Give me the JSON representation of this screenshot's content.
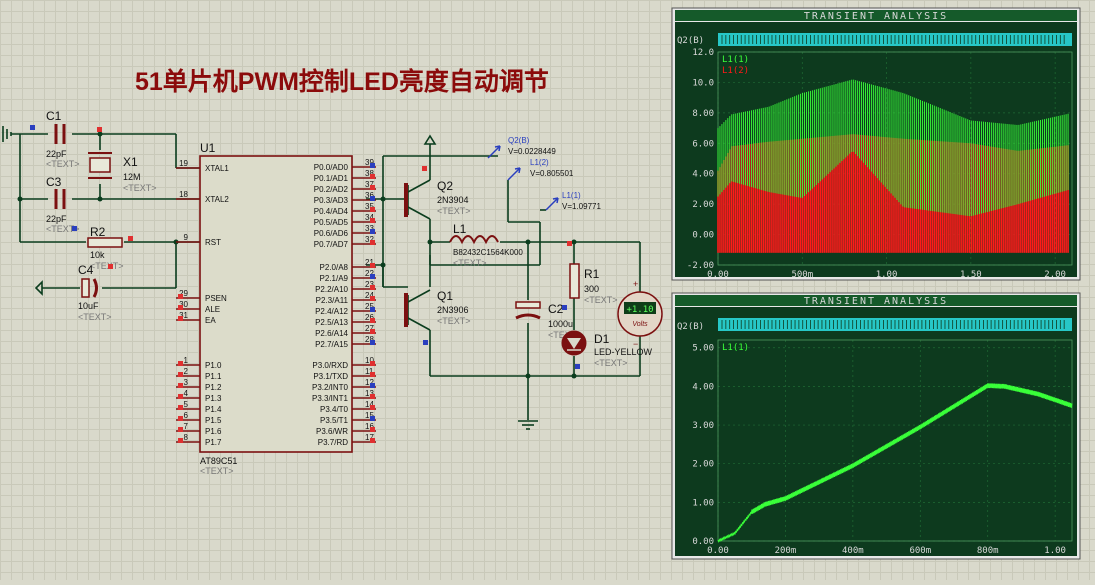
{
  "title": "51单片机PWM控制LED亮度自动调节",
  "mcu": {
    "ref": "U1",
    "part": "AT89C51",
    "text": "<TEXT>",
    "left_pins": [
      {
        "num": "19",
        "name": "XTAL1"
      },
      {
        "num": "18",
        "name": "XTAL2"
      },
      {
        "num": "9",
        "name": "RST"
      },
      {
        "num": "29",
        "name": "PSEN"
      },
      {
        "num": "30",
        "name": "ALE"
      },
      {
        "num": "31",
        "name": "EA"
      },
      {
        "num": "1",
        "name": "P1.0"
      },
      {
        "num": "2",
        "name": "P1.1"
      },
      {
        "num": "3",
        "name": "P1.2"
      },
      {
        "num": "4",
        "name": "P1.3"
      },
      {
        "num": "5",
        "name": "P1.4"
      },
      {
        "num": "6",
        "name": "P1.5"
      },
      {
        "num": "7",
        "name": "P1.6"
      },
      {
        "num": "8",
        "name": "P1.7"
      }
    ],
    "right_pins": [
      {
        "num": "39",
        "name": "P0.0/AD0"
      },
      {
        "num": "38",
        "name": "P0.1/AD1"
      },
      {
        "num": "37",
        "name": "P0.2/AD2"
      },
      {
        "num": "36",
        "name": "P0.3/AD3"
      },
      {
        "num": "35",
        "name": "P0.4/AD4"
      },
      {
        "num": "34",
        "name": "P0.5/AD5"
      },
      {
        "num": "33",
        "name": "P0.6/AD6"
      },
      {
        "num": "32",
        "name": "P0.7/AD7"
      },
      {
        "num": "21",
        "name": "P2.0/A8"
      },
      {
        "num": "22",
        "name": "P2.1/A9"
      },
      {
        "num": "23",
        "name": "P2.2/A10"
      },
      {
        "num": "24",
        "name": "P2.3/A11"
      },
      {
        "num": "25",
        "name": "P2.4/A12"
      },
      {
        "num": "26",
        "name": "P2.5/A13"
      },
      {
        "num": "27",
        "name": "P2.6/A14"
      },
      {
        "num": "28",
        "name": "P2.7/A15"
      },
      {
        "num": "10",
        "name": "P3.0/RXD"
      },
      {
        "num": "11",
        "name": "P3.1/TXD"
      },
      {
        "num": "12",
        "name": "P3.2/INT0"
      },
      {
        "num": "13",
        "name": "P3.3/INT1"
      },
      {
        "num": "14",
        "name": "P3.4/T0"
      },
      {
        "num": "15",
        "name": "P3.5/T1"
      },
      {
        "num": "16",
        "name": "P3.6/WR"
      },
      {
        "num": "17",
        "name": "P3.7/RD"
      }
    ]
  },
  "components": {
    "c1": {
      "ref": "C1",
      "value": "22pF",
      "text": "<TEXT>"
    },
    "c3": {
      "ref": "C3",
      "value": "22pF",
      "text": "<TEXT>"
    },
    "x1": {
      "ref": "X1",
      "value": "12M",
      "text": "<TEXT>"
    },
    "r2": {
      "ref": "R2",
      "value": "10k",
      "text": "<TEXT>"
    },
    "c4": {
      "ref": "C4",
      "value": "10uF",
      "text": "<TEXT>"
    },
    "q2": {
      "ref": "Q2",
      "value": "2N3904",
      "text": "<TEXT>"
    },
    "q1": {
      "ref": "Q1",
      "value": "2N3906",
      "text": "<TEXT>"
    },
    "l1": {
      "ref": "L1",
      "value": "B82432C1564K000",
      "text": "<TEXT>"
    },
    "c2": {
      "ref": "C2",
      "value": "1000u",
      "text": "<TEXT>"
    },
    "r1": {
      "ref": "R1",
      "value": "300",
      "text": "<TEXT>"
    },
    "d1": {
      "ref": "D1",
      "value": "LED-YELLOW",
      "text": "<TEXT>"
    }
  },
  "probes": [
    {
      "name": "Q2(B)",
      "value": "V=0.0228449"
    },
    {
      "name": "L1(2)",
      "value": "V=0.805501"
    },
    {
      "name": "L1(1)",
      "value": "V=1.09771"
    }
  ],
  "voltmeter": {
    "reading": "+1.10",
    "unit": "Volts"
  },
  "graph1": {
    "title": "TRANSIENT ANALYSIS",
    "digital_label": "Q2(B)",
    "legend": [
      "L1(1)",
      "L1(2)"
    ],
    "y_ticks": [
      "12.0",
      "10.0",
      "8.00",
      "6.00",
      "4.00",
      "2.00",
      "0.00",
      "-2.00"
    ],
    "x_ticks": [
      "0.00",
      "500m",
      "1.00",
      "1.50",
      "2.00"
    ],
    "colors": {
      "bg": "#0d3a1e",
      "series1": "#39ff39",
      "series2": "#ff1a1a",
      "digital": "#27c7c7",
      "axis": "#d8d8d8"
    }
  },
  "graph2": {
    "title": "TRANSIENT ANALYSIS",
    "digital_label": "Q2(B)",
    "legend": [
      "L1(1)"
    ],
    "y_ticks": [
      "5.00",
      "4.00",
      "3.00",
      "2.00",
      "1.00",
      "0.00"
    ],
    "x_ticks": [
      "0.00",
      "200m",
      "400m",
      "600m",
      "800m",
      "1.00"
    ],
    "colors": {
      "bg": "#0d3a1e",
      "series1": "#39ff39",
      "digital": "#27c7c7",
      "axis": "#d8d8d8"
    }
  },
  "chart_data": [
    {
      "type": "line",
      "title": "TRANSIENT ANALYSIS",
      "ylim": [
        -2,
        12
      ],
      "xlim": [
        0,
        2.1
      ],
      "grid": true,
      "series": [
        {
          "name": "L1(1)",
          "x": [
            0,
            0.08,
            0.3,
            0.5,
            0.8,
            1.1,
            1.5,
            1.78,
            2.1
          ],
          "upper": [
            7,
            7.9,
            8.4,
            9.3,
            10.2,
            9.3,
            7.5,
            7.2,
            8
          ],
          "lower": [
            2.5,
            3.5,
            2.8,
            2.4,
            5.5,
            1.8,
            1.2,
            2.0,
            3.0
          ]
        },
        {
          "name": "L1(2)",
          "x": [
            0,
            0.08,
            0.3,
            0.5,
            0.8,
            1.1,
            1.5,
            1.78,
            2.1
          ],
          "upper": [
            4.2,
            5.8,
            6.1,
            6.3,
            6.6,
            6.3,
            6.0,
            5.5,
            5.9
          ],
          "lower": [
            -1.2,
            -1.2,
            -1.2,
            -1.2,
            -1.2,
            -1.2,
            -1.2,
            -1.2,
            -1.2
          ]
        }
      ]
    },
    {
      "type": "line",
      "title": "TRANSIENT ANALYSIS",
      "ylim": [
        0,
        5.2
      ],
      "xlim": [
        0,
        1.05
      ],
      "grid": true,
      "series": [
        {
          "name": "L1(1)",
          "x": [
            0,
            0.05,
            0.1,
            0.14,
            0.2,
            0.4,
            0.6,
            0.8,
            0.85,
            0.95,
            1.05
          ],
          "y": [
            0,
            0.2,
            0.75,
            0.95,
            1.1,
            1.95,
            2.95,
            4.02,
            4.0,
            3.8,
            3.5
          ]
        }
      ]
    }
  ]
}
